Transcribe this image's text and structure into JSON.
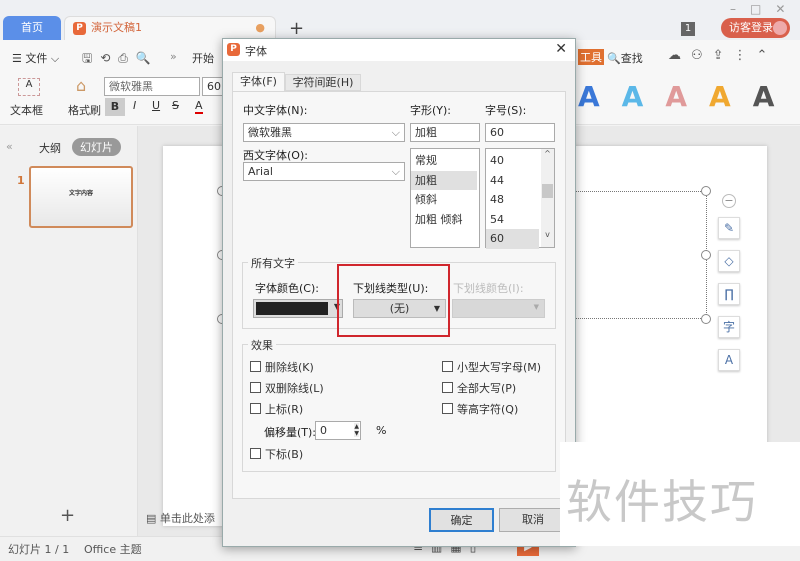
{
  "tabs": {
    "home": "首页",
    "doc": "演示文稿1",
    "new": "+"
  },
  "window": {
    "badge": "1",
    "login": "访客登录"
  },
  "menu": {
    "file": "文件",
    "start": "开始",
    "find": "查找",
    "tools": "工具",
    "more": "»"
  },
  "ribbon": {
    "textbox": "文本框",
    "format_painter": "格式刷",
    "font": "微软雅黑",
    "size": "60",
    "bold": "B",
    "italic": "I",
    "underline": "U",
    "strike": "S",
    "color": "A"
  },
  "wordart_colors": [
    "#3a78d8",
    "#5bb8e8",
    "#e09a9a",
    "#f0a830",
    "#555555"
  ],
  "sidebar": {
    "outline": "大纲",
    "slides": "幻灯片",
    "slide_num": "1",
    "thumb_text": "文字内容",
    "add": "+"
  },
  "notes": "单击此处添",
  "status": {
    "slide": "幻灯片 1 / 1",
    "theme": "Office 主题"
  },
  "dialog": {
    "title": "字体",
    "tabs": [
      "字体(F)",
      "字符间距(H)"
    ],
    "cn_font_label": "中文字体(N):",
    "cn_font": "微软雅黑",
    "west_font_label": "西文字体(O):",
    "west_font": "Arial",
    "style_label": "字形(Y):",
    "style": "加粗",
    "style_options": [
      "常规",
      "加粗",
      "倾斜",
      "加粗 倾斜"
    ],
    "style_selected": "加粗",
    "size_label": "字号(S):",
    "size": "60",
    "size_options": [
      "40",
      "44",
      "48",
      "54",
      "60"
    ],
    "size_selected": "60",
    "all_text": "所有文字",
    "color_label": "字体颜色(C):",
    "font_color": "#222222",
    "underline_label": "下划线类型(U):",
    "underline": "(无)",
    "underline_color_label": "下划线颜色(I):",
    "effects": "效果",
    "effects_left": [
      "删除线(K)",
      "双删除线(L)",
      "上标(R)"
    ],
    "offset_label": "偏移量(T):",
    "offset": "0",
    "offset_unit": "%",
    "subscript": "下标(B)",
    "effects_right": [
      "小型大写字母(M)",
      "全部大写(P)",
      "等高字符(Q)"
    ],
    "ok": "确定",
    "cancel": "取消"
  },
  "highlight_color": "#d0262d",
  "watermark": "软件技巧"
}
